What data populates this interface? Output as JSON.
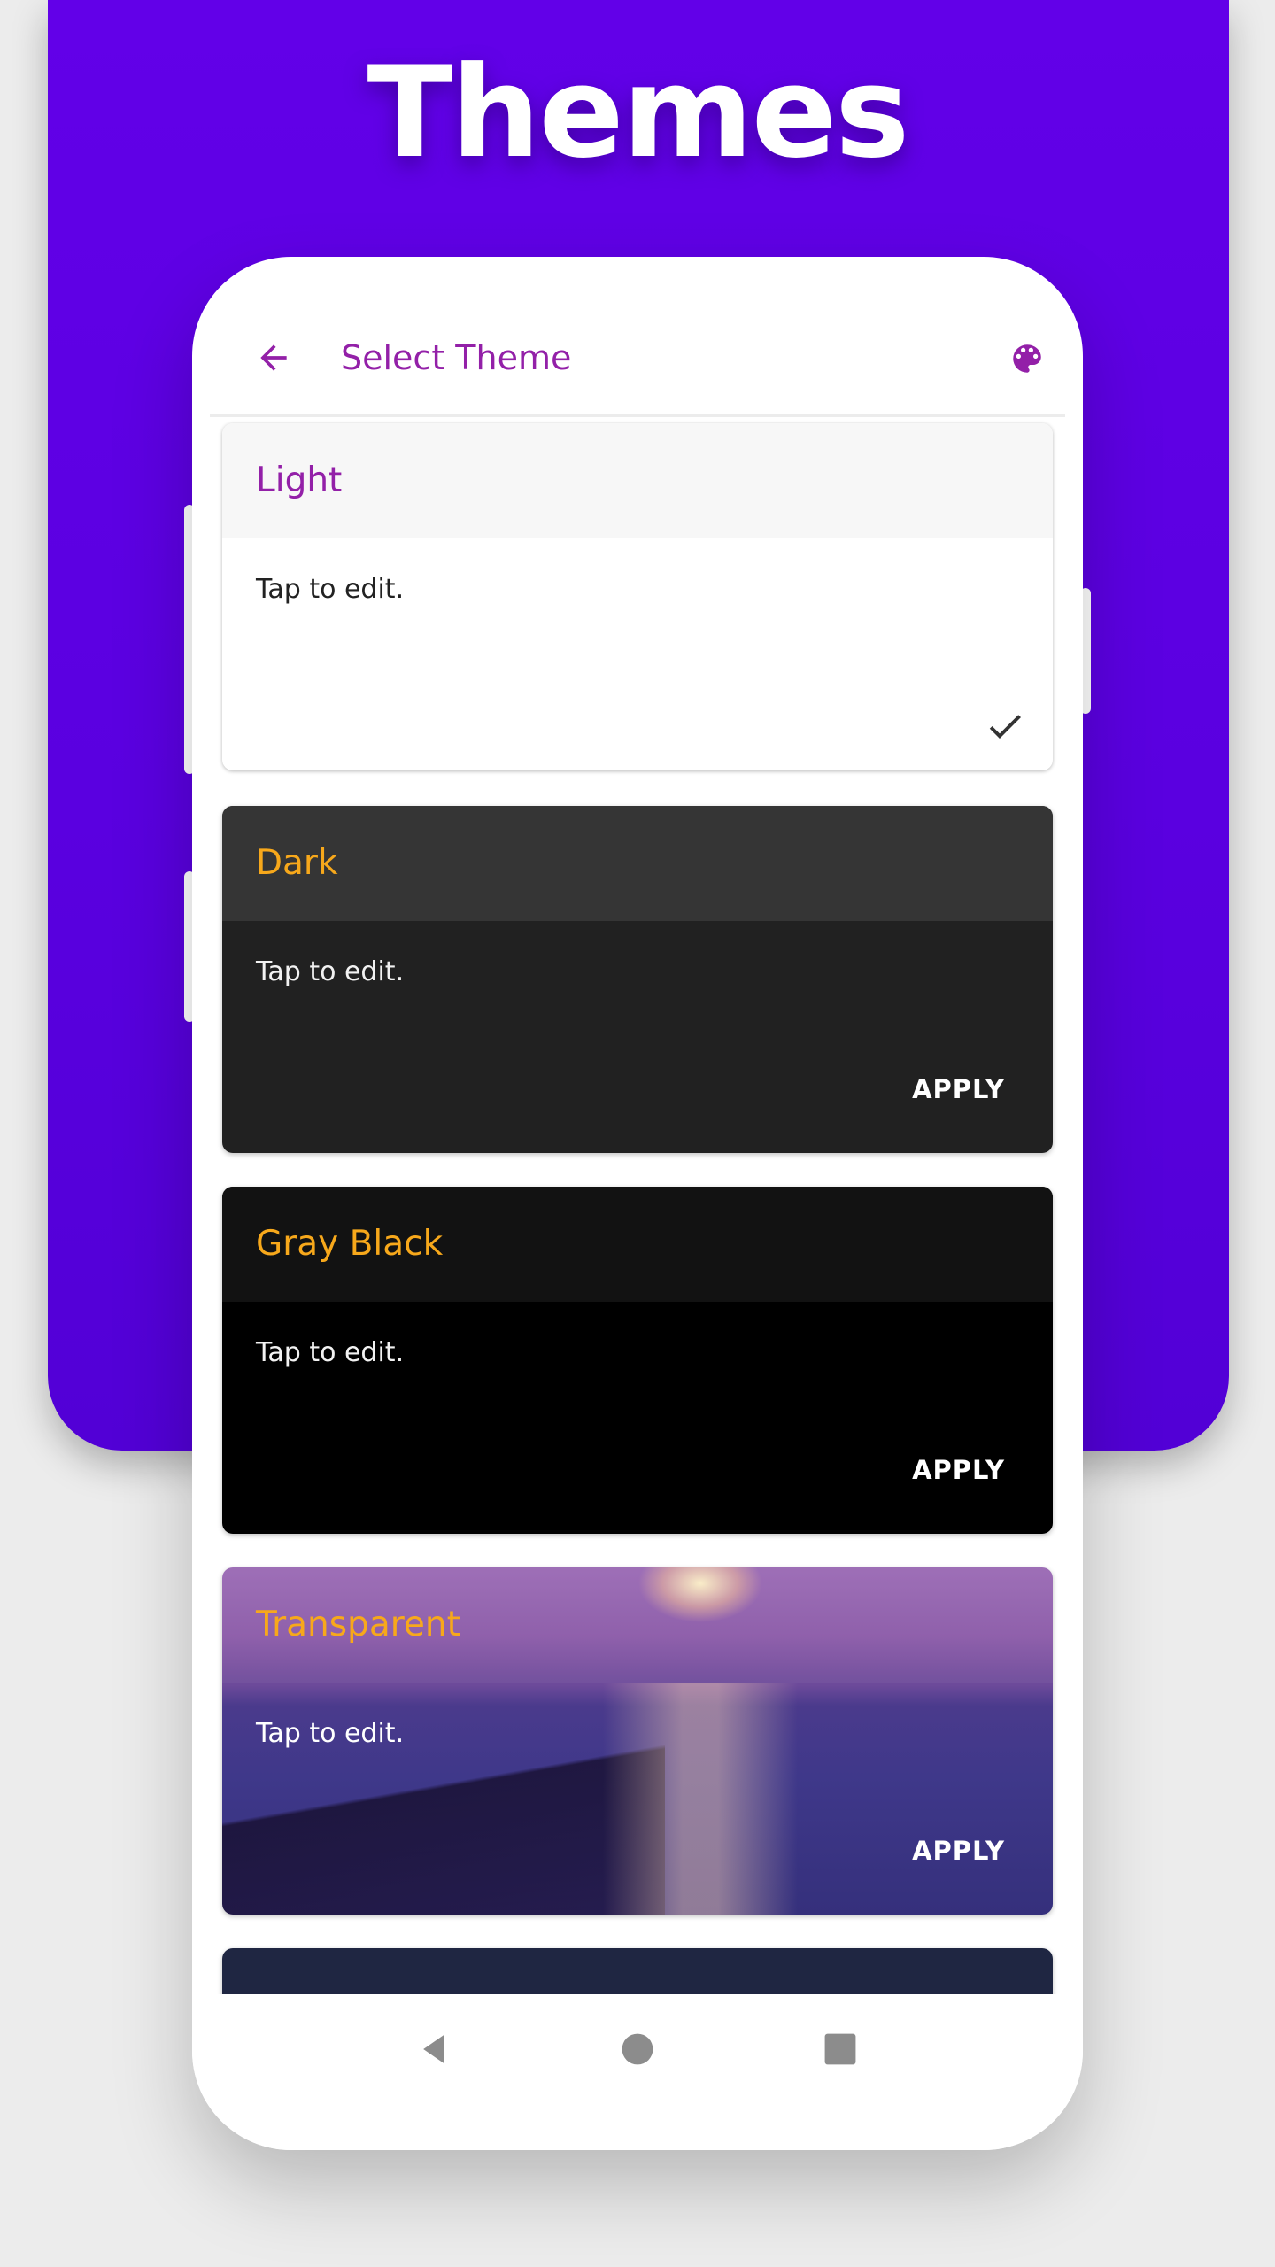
{
  "hero": {
    "title": "Themes",
    "background_color": "#6200e8"
  },
  "app_bar": {
    "title": "Select Theme",
    "back_icon": "arrow-left-icon",
    "action_icon": "palette-icon",
    "accent_color": "#9320a8"
  },
  "themes": [
    {
      "name": "Light",
      "subtitle": "Tap to edit.",
      "selected": true,
      "selected_icon": "check-icon",
      "title_color": "#9320a8",
      "header_color": "#f7f7f7",
      "body_color": "#ffffff"
    },
    {
      "name": "Dark",
      "subtitle": "Tap to edit.",
      "selected": false,
      "action_label": "APPLY",
      "title_color": "#f7a81b",
      "header_color": "#353535",
      "body_color": "#212121"
    },
    {
      "name": "Gray Black",
      "subtitle": "Tap to edit.",
      "selected": false,
      "action_label": "APPLY",
      "title_color": "#f7a81b",
      "header_color": "#121212",
      "body_color": "#000000"
    },
    {
      "name": "Transparent",
      "subtitle": "Tap to edit.",
      "selected": false,
      "action_label": "APPLY",
      "title_color": "#f7a81b",
      "background_icon": "sunset-sea-image"
    },
    {
      "body_color": "#1f2642"
    }
  ],
  "nav_bar": {
    "back_icon": "nav-back-triangle-icon",
    "home_icon": "nav-home-circle-icon",
    "recents_icon": "nav-recents-square-icon"
  }
}
